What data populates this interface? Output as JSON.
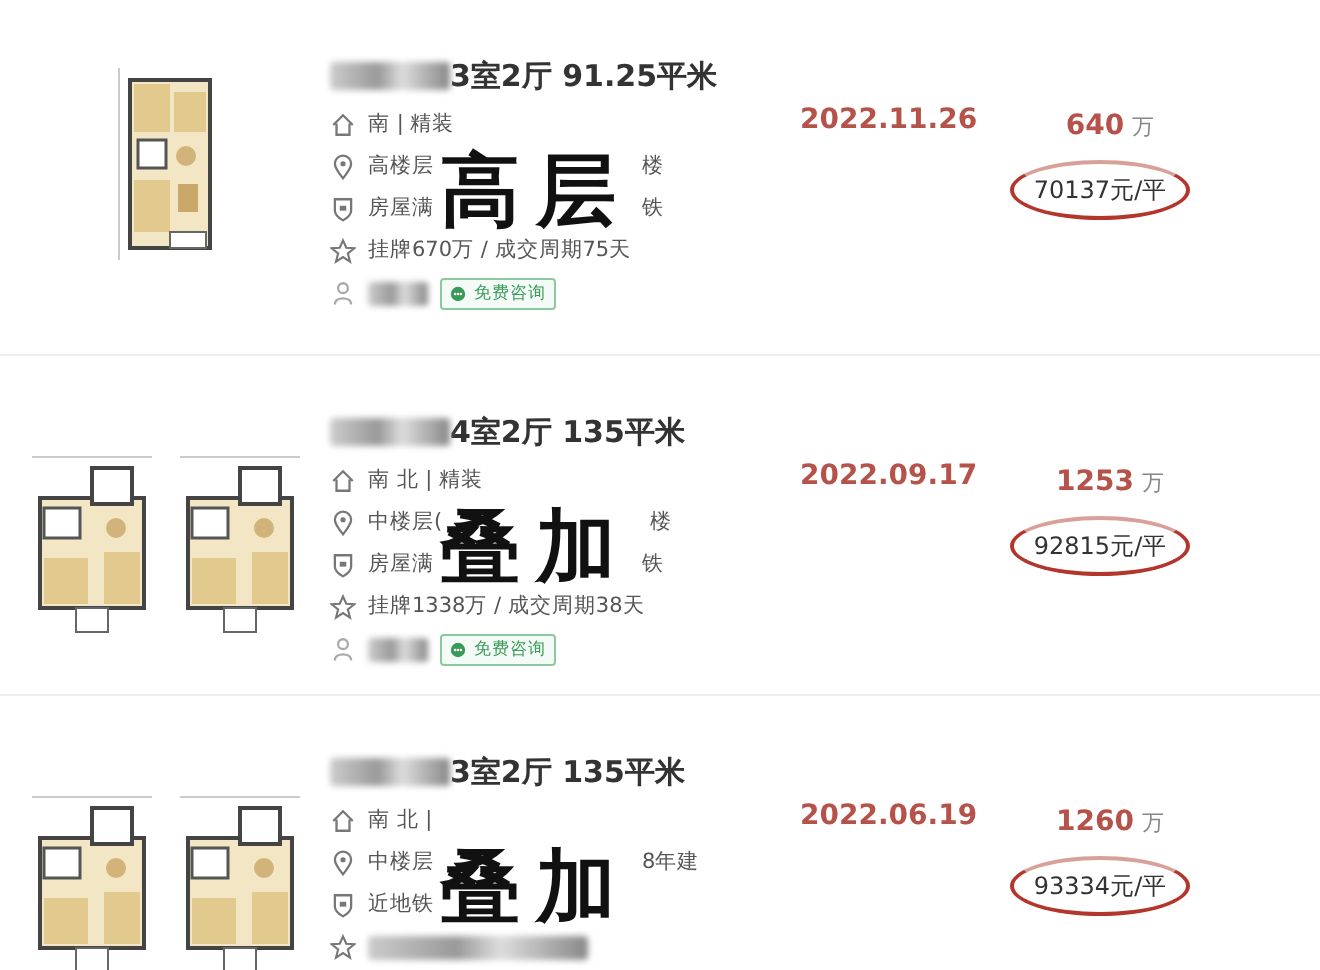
{
  "listings": [
    {
      "floor_plans": [
        {
          "kind": "picture"
        }
      ],
      "title_redacted": true,
      "title": "3室2厅 91.25平米",
      "overlay": "高层",
      "date": "2022.11.26",
      "price": "640",
      "price_unit": "万",
      "unit_price": "70137元/平",
      "details": [
        {
          "kind": "orientation",
          "parts": [
            "南 | 精装"
          ],
          "redacted": false
        },
        {
          "kind": "floor",
          "parts": [
            "高楼层",
            "楼"
          ],
          "redacted": false
        },
        {
          "kind": "tag",
          "parts": [
            "房屋满",
            "铁"
          ],
          "redacted": false
        },
        {
          "kind": "listing",
          "parts": [
            "挂牌670万 / 成交周期75天"
          ],
          "redacted": false
        },
        {
          "kind": "agent",
          "button": "免费咨询",
          "redacted": true
        }
      ]
    },
    {
      "floor_plans": [
        {
          "kind": "picture"
        },
        {
          "kind": "picture"
        }
      ],
      "title_redacted": true,
      "title": "4室2厅 135平米",
      "overlay": "叠加",
      "date": "2022.09.17",
      "price": "1253",
      "price_unit": "万",
      "unit_price": "92815元/平",
      "details": [
        {
          "kind": "orientation",
          "parts": [
            "南 北 | 精装"
          ],
          "redacted": false
        },
        {
          "kind": "floor",
          "parts": [
            "中楼层(",
            "楼"
          ],
          "redacted": false
        },
        {
          "kind": "tag",
          "parts": [
            "房屋满",
            "铁"
          ],
          "redacted": false
        },
        {
          "kind": "listing",
          "parts": [
            "挂牌1338万 / 成交周期38天"
          ],
          "redacted": false
        },
        {
          "kind": "agent",
          "button": "免费咨询",
          "redacted": true
        }
      ]
    },
    {
      "floor_plans": [
        {
          "kind": "picture"
        },
        {
          "kind": "picture"
        }
      ],
      "title_redacted": true,
      "title": "3室2厅 135平米",
      "overlay": "叠加",
      "date": "2022.06.19",
      "price": "1260",
      "price_unit": "万",
      "unit_price": "93334元/平",
      "details": [
        {
          "kind": "orientation",
          "parts": [
            "南 北 |"
          ],
          "redacted": false
        },
        {
          "kind": "floor",
          "parts": [
            "中楼层",
            "8年建"
          ],
          "redacted": false
        },
        {
          "kind": "tag",
          "parts": [
            "近地铁"
          ],
          "redacted": false
        },
        {
          "kind": "listing",
          "redacted": true
        }
      ]
    }
  ]
}
